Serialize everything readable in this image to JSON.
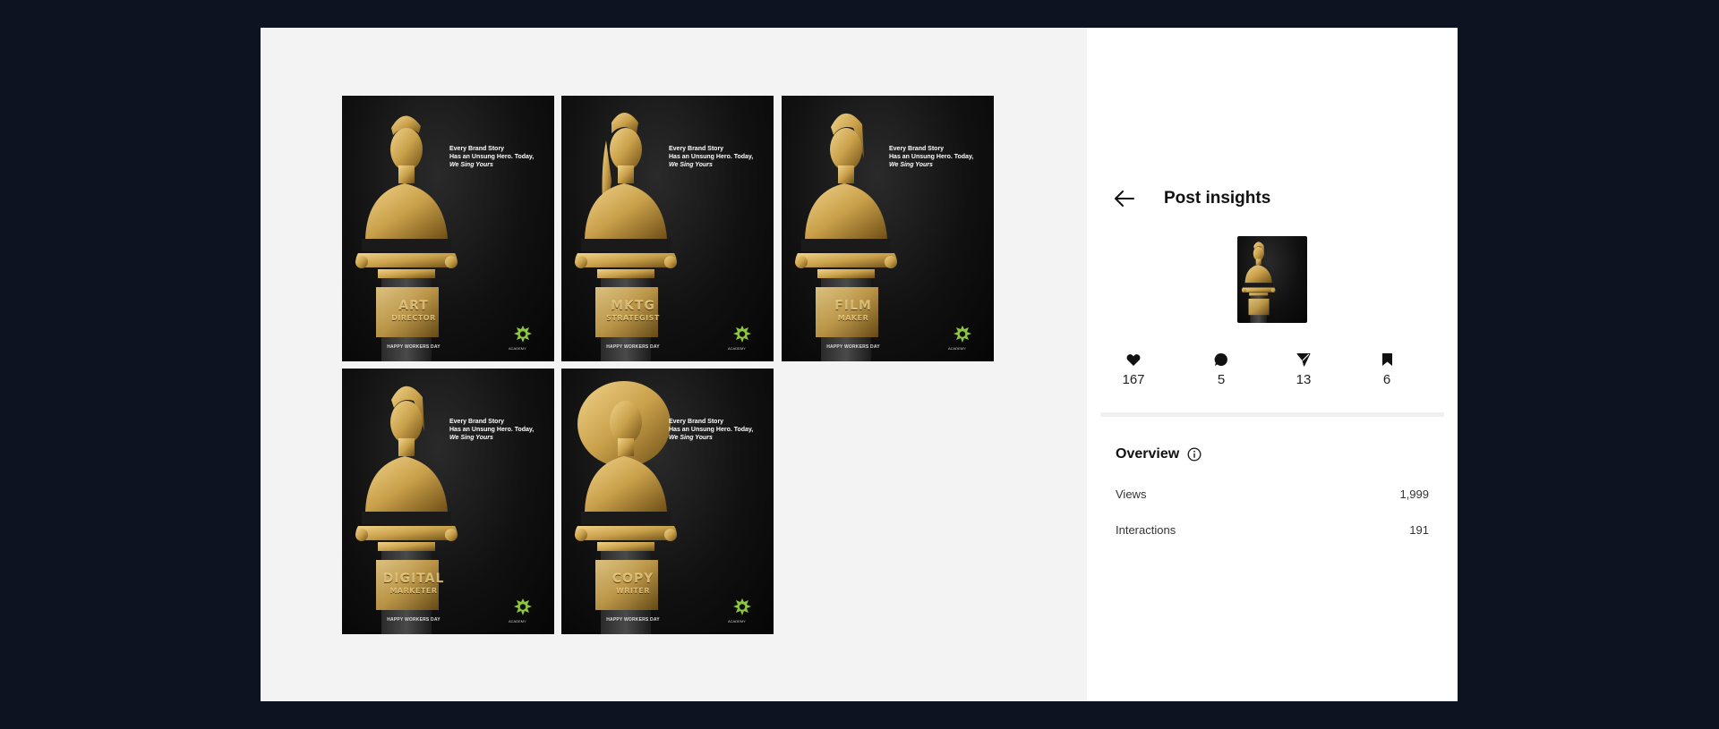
{
  "gallery": {
    "posts": [
      {
        "tagline": [
          "Every Brand Story",
          "Has an Unsung Hero. Today,",
          "We Sing Yours"
        ],
        "plaque": [
          "ART",
          "DIRECTOR"
        ],
        "footer": "HAPPY WORKERS DAY",
        "logo_text": "ACADEMY",
        "hair": "short"
      },
      {
        "tagline": [
          "Every Brand Story",
          "Has an Unsung Hero. Today,",
          "We Sing Yours"
        ],
        "plaque": [
          "MKTG",
          "STRATEGIST"
        ],
        "footer": "HAPPY WORKERS DAY",
        "logo_text": "ACADEMY",
        "hair": "braid"
      },
      {
        "tagline": [
          "Every Brand Story",
          "Has an Unsung Hero. Today,",
          "We Sing Yours"
        ],
        "plaque": [
          "FILM",
          "MAKER"
        ],
        "footer": "HAPPY WORKERS DAY",
        "logo_text": "ACADEMY",
        "hair": "cornrow"
      },
      {
        "tagline": [
          "Every Brand Story",
          "Has an Unsung Hero. Today,",
          "We Sing Yours"
        ],
        "plaque": [
          "DIGITAL",
          "MARKETER"
        ],
        "footer": "HAPPY WORKERS DAY",
        "logo_text": "ACADEMY",
        "hair": "cornrow"
      },
      {
        "tagline": [
          "Every Brand Story",
          "Has an Unsung Hero. Today,",
          "We Sing Yours"
        ],
        "plaque": [
          "COPY",
          "WRITER"
        ],
        "footer": "HAPPY WORKERS DAY",
        "logo_text": "ACADEMY",
        "hair": "afro"
      }
    ]
  },
  "insights": {
    "title": "Post insights",
    "back_icon": "arrow-left-icon",
    "stats": [
      {
        "icon": "heart-icon",
        "value": "167"
      },
      {
        "icon": "comment-icon",
        "value": "5"
      },
      {
        "icon": "send-icon",
        "value": "13"
      },
      {
        "icon": "bookmark-icon",
        "value": "6"
      }
    ],
    "overview": {
      "title": "Overview",
      "info_icon": "info-icon",
      "metrics": [
        {
          "label": "Views",
          "value": "1,999"
        },
        {
          "label": "Interactions",
          "value": "191"
        }
      ]
    }
  },
  "colors": {
    "page_bg": "#0d1421",
    "gallery_bg": "#f3f3f3",
    "panel_bg": "#ffffff",
    "gold": "#c9a04a",
    "logo_green": "#8dc63f"
  }
}
